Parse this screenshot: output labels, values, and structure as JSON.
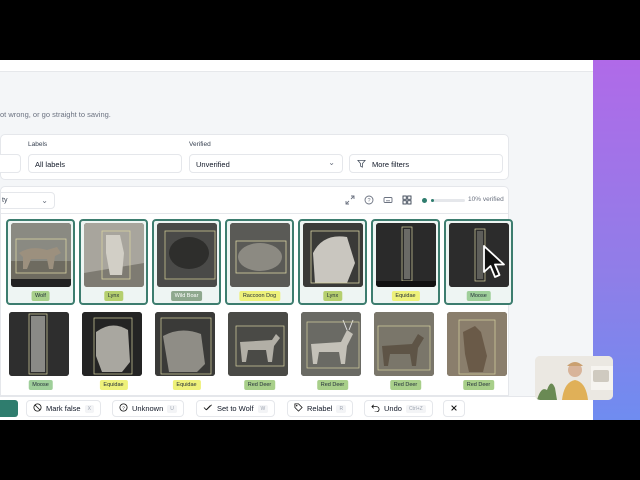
{
  "topbar": {
    "text": ""
  },
  "hint": "ot wrong, or go straight to saving.",
  "filters": {
    "labels_title": "Labels",
    "labels_value": "All labels",
    "verified_title": "Verified",
    "verified_value": "Unverified",
    "more_filters": "More filters"
  },
  "toolbar": {
    "sort_value": "ty",
    "progress_text": "10% verified",
    "progress_fraction": 0.1
  },
  "tiles_row1": [
    {
      "label": "Wolf",
      "tag_color": "green"
    },
    {
      "label": "Lynx",
      "tag_color": "olive"
    },
    {
      "label": "Wild Boar",
      "tag_color": "gray"
    },
    {
      "label": "Raccoon Dog",
      "tag_color": "yellow"
    },
    {
      "label": "Lynx",
      "tag_color": "olive"
    },
    {
      "label": "Equidae",
      "tag_color": "yellow"
    },
    {
      "label": "Moose",
      "tag_color": "mint"
    }
  ],
  "tiles_row2": [
    {
      "label": "Moose",
      "tag_color": "mint"
    },
    {
      "label": "Equidae",
      "tag_color": "yellow"
    },
    {
      "label": "Equidae",
      "tag_color": "yellow"
    },
    {
      "label": "Red Deer",
      "tag_color": "green"
    },
    {
      "label": "Red Deer",
      "tag_color": "green"
    },
    {
      "label": "Red Deer",
      "tag_color": "green"
    },
    {
      "label": "Red Deer",
      "tag_color": "green"
    }
  ],
  "bottom_bar": {
    "mark_false": "Mark false",
    "mark_false_key": "X",
    "unknown": "Unknown",
    "unknown_key": "U",
    "set_to": "Set to Wolf",
    "set_to_key": "W",
    "relabel": "Relabel",
    "relabel_key": "R",
    "undo": "Undo",
    "undo_key": "Ctrl+Z"
  },
  "colors": {
    "accent": "#2f7d6e",
    "selected_border": "#3d7d6f"
  }
}
